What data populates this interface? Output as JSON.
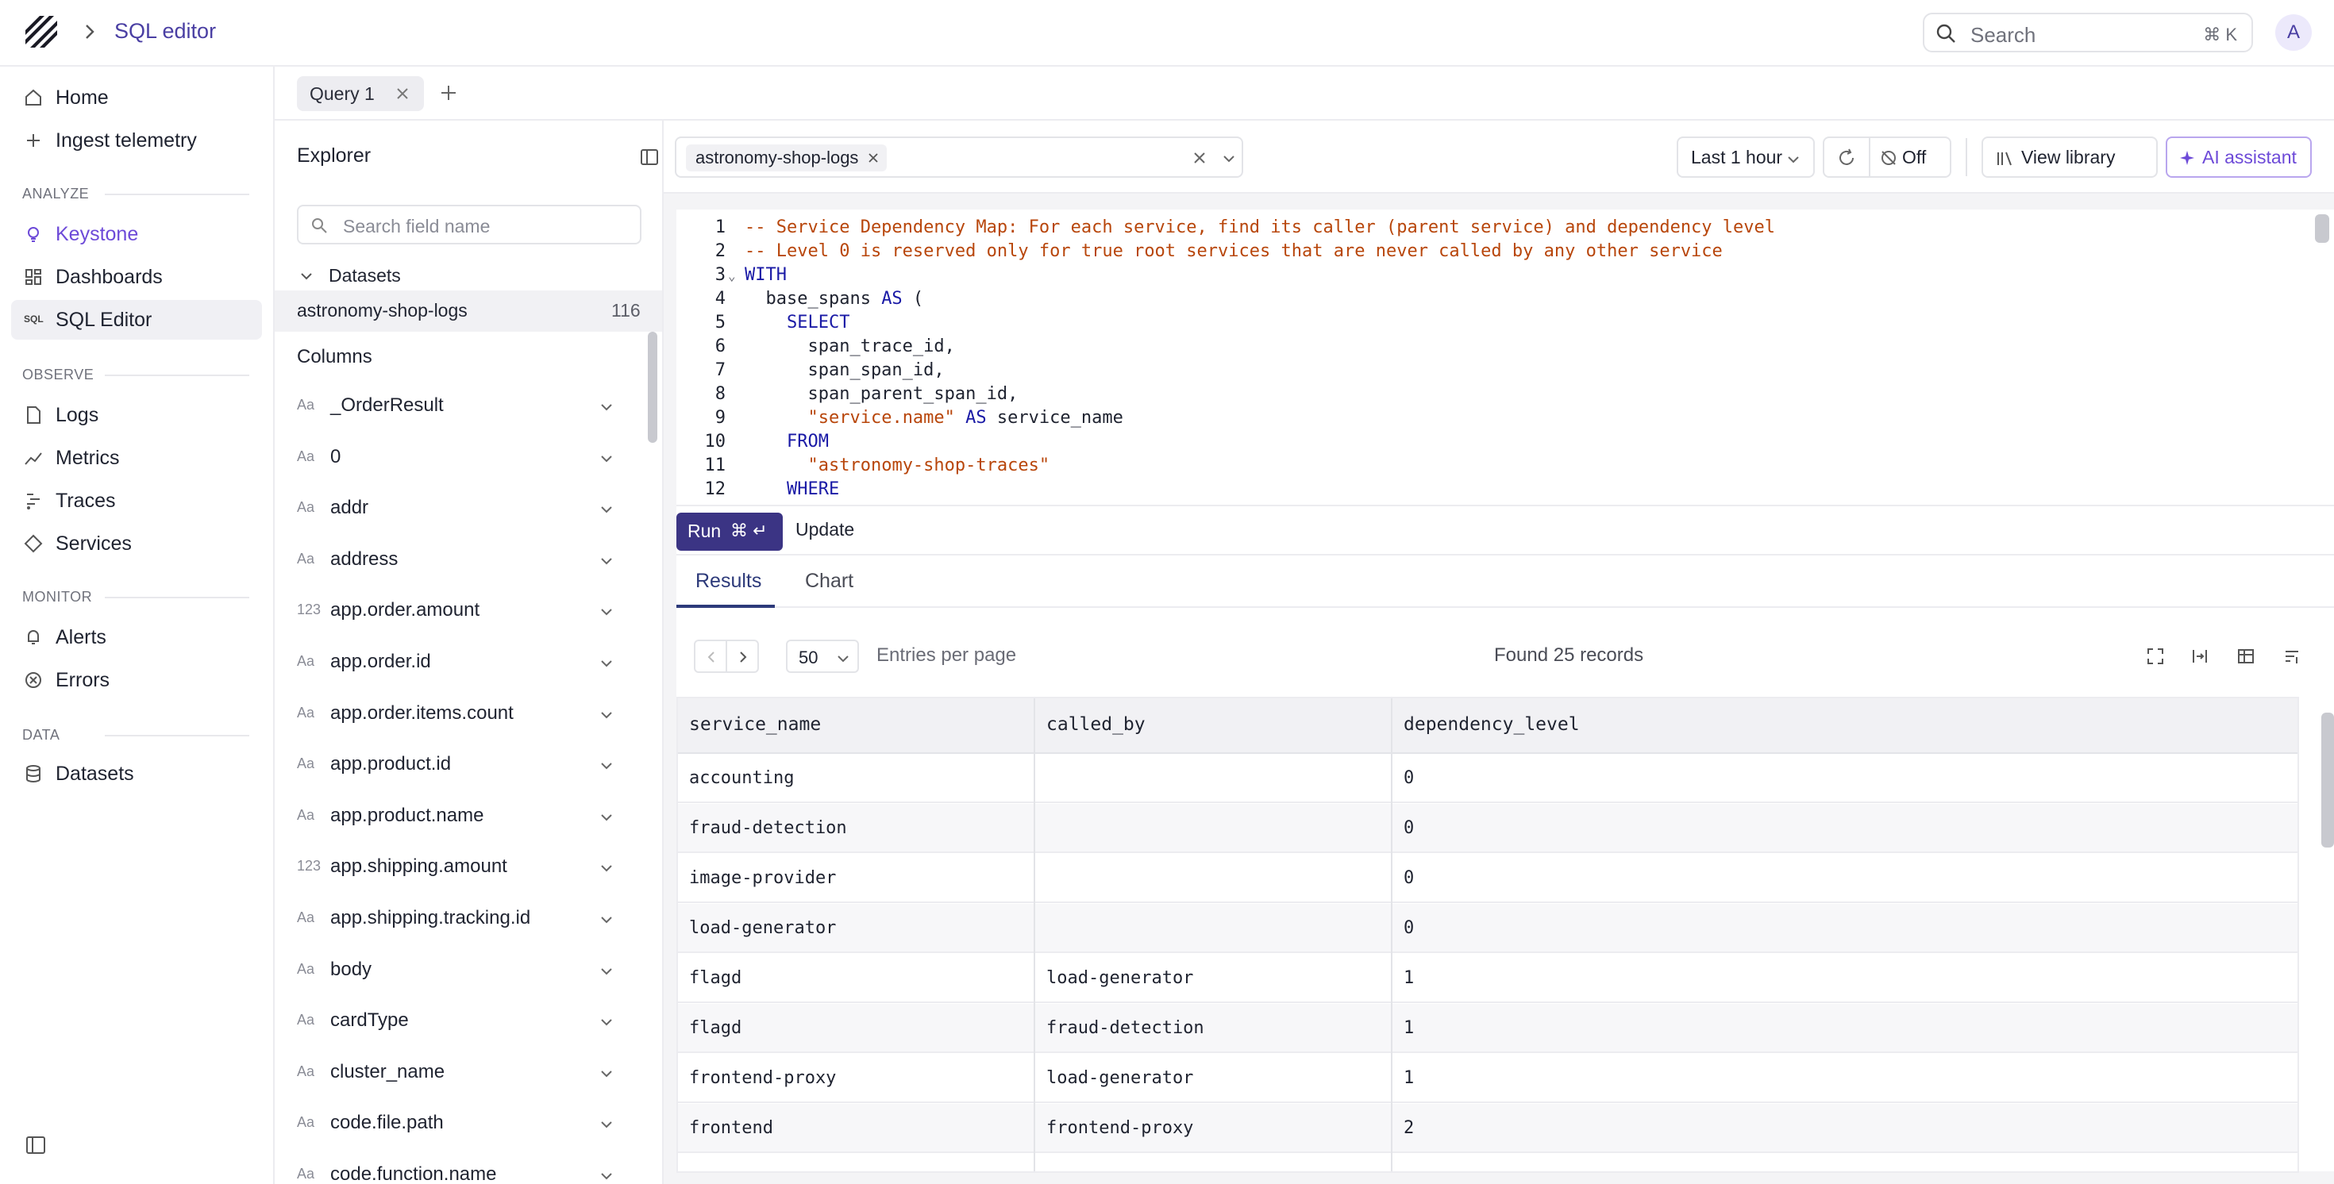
{
  "header": {
    "breadcrumb_title": "SQL editor",
    "search_placeholder": "Search",
    "search_shortcut": "⌘ K",
    "avatar_initial": "A"
  },
  "nav": {
    "items_top": [
      {
        "label": "Home",
        "icon": "home-icon"
      },
      {
        "label": "Ingest telemetry",
        "icon": "plus-icon"
      }
    ],
    "section_analyze": "ANALYZE",
    "items_analyze": [
      {
        "label": "Keystone",
        "icon": "lightbulb-icon"
      },
      {
        "label": "Dashboards",
        "icon": "dashboard-icon"
      },
      {
        "label": "SQL Editor",
        "icon": "sql-icon"
      }
    ],
    "sql_icon_text": "SQL",
    "section_observe": "OBSERVE",
    "items_observe": [
      {
        "label": "Logs",
        "icon": "document-icon"
      },
      {
        "label": "Metrics",
        "icon": "chart-line-icon"
      },
      {
        "label": "Traces",
        "icon": "traces-icon"
      },
      {
        "label": "Services",
        "icon": "services-icon"
      }
    ],
    "section_monitor": "MONITOR",
    "items_monitor": [
      {
        "label": "Alerts",
        "icon": "bell-icon"
      },
      {
        "label": "Errors",
        "icon": "error-icon"
      }
    ],
    "section_data": "DATA",
    "items_data": [
      {
        "label": "Datasets",
        "icon": "database-icon"
      }
    ],
    "accent_color": "#6d4ad8"
  },
  "tabs": {
    "query_tab_label": "Query 1"
  },
  "explorer": {
    "title": "Explorer",
    "search_placeholder": "Search field name",
    "datasets_label": "Datasets",
    "dataset": {
      "name": "astronomy-shop-logs",
      "count": "116"
    },
    "columns_label": "Columns",
    "columns": [
      {
        "type": "Aa",
        "name": "_OrderResult"
      },
      {
        "type": "Aa",
        "name": "0"
      },
      {
        "type": "Aa",
        "name": "addr"
      },
      {
        "type": "Aa",
        "name": "address"
      },
      {
        "type": "123",
        "name": "app.order.amount"
      },
      {
        "type": "Aa",
        "name": "app.order.id"
      },
      {
        "type": "Aa",
        "name": "app.order.items.count"
      },
      {
        "type": "Aa",
        "name": "app.product.id"
      },
      {
        "type": "Aa",
        "name": "app.product.name"
      },
      {
        "type": "123",
        "name": "app.shipping.amount"
      },
      {
        "type": "Aa",
        "name": "app.shipping.tracking.id"
      },
      {
        "type": "Aa",
        "name": "body"
      },
      {
        "type": "Aa",
        "name": "cardType"
      },
      {
        "type": "Aa",
        "name": "cluster_name"
      },
      {
        "type": "Aa",
        "name": "code.file.path"
      },
      {
        "type": "Aa",
        "name": "code.function.name"
      }
    ]
  },
  "toolbar": {
    "dataset_chip": "astronomy-shop-logs",
    "time_range": "Last 1 hour",
    "refresh_state": "Off",
    "view_library": "View library",
    "ai_assistant": "AI assistant"
  },
  "editor": {
    "lines": [
      [
        {
          "c": "comment",
          "t": "-- Service Dependency Map: For each service, find its caller (parent service) and dependency level"
        }
      ],
      [
        {
          "c": "comment",
          "t": "-- Level 0 is reserved only for true root services that are never called by any other service"
        }
      ],
      [
        {
          "c": "kw",
          "t": "WITH"
        }
      ],
      [
        {
          "c": "plain",
          "t": "  base_spans "
        },
        {
          "c": "kw",
          "t": "AS"
        },
        {
          "c": "plain",
          "t": " ("
        }
      ],
      [
        {
          "c": "plain",
          "t": "    "
        },
        {
          "c": "kw",
          "t": "SELECT"
        }
      ],
      [
        {
          "c": "plain",
          "t": "      span_trace_id,"
        }
      ],
      [
        {
          "c": "plain",
          "t": "      span_span_id,"
        }
      ],
      [
        {
          "c": "plain",
          "t": "      span_parent_span_id,"
        }
      ],
      [
        {
          "c": "plain",
          "t": "      "
        },
        {
          "c": "str",
          "t": "\"service.name\""
        },
        {
          "c": "plain",
          "t": " "
        },
        {
          "c": "kw",
          "t": "AS"
        },
        {
          "c": "plain",
          "t": " service_name"
        }
      ],
      [
        {
          "c": "plain",
          "t": "    "
        },
        {
          "c": "kw",
          "t": "FROM"
        }
      ],
      [
        {
          "c": "plain",
          "t": "      "
        },
        {
          "c": "str",
          "t": "\"astronomy-shop-traces\""
        }
      ],
      [
        {
          "c": "plain",
          "t": "    "
        },
        {
          "c": "kw",
          "t": "WHERE"
        }
      ]
    ],
    "fold_marker": "⌄"
  },
  "run": {
    "run_label": "Run",
    "run_shortcut": "⌘ ↵",
    "update_label": "Update"
  },
  "results": {
    "tab_results": "Results",
    "tab_chart": "Chart",
    "per_page": "50",
    "per_page_label": "Entries per page",
    "found": "Found 25 records",
    "columns": [
      "service_name",
      "called_by",
      "dependency_level"
    ],
    "rows": [
      [
        "accounting",
        "",
        "0"
      ],
      [
        "fraud-detection",
        "",
        "0"
      ],
      [
        "image-provider",
        "",
        "0"
      ],
      [
        "load-generator",
        "",
        "0"
      ],
      [
        "flagd",
        "load-generator",
        "1"
      ],
      [
        "flagd",
        "fraud-detection",
        "1"
      ],
      [
        "frontend-proxy",
        "load-generator",
        "1"
      ],
      [
        "frontend",
        "frontend-proxy",
        "2"
      ]
    ]
  }
}
